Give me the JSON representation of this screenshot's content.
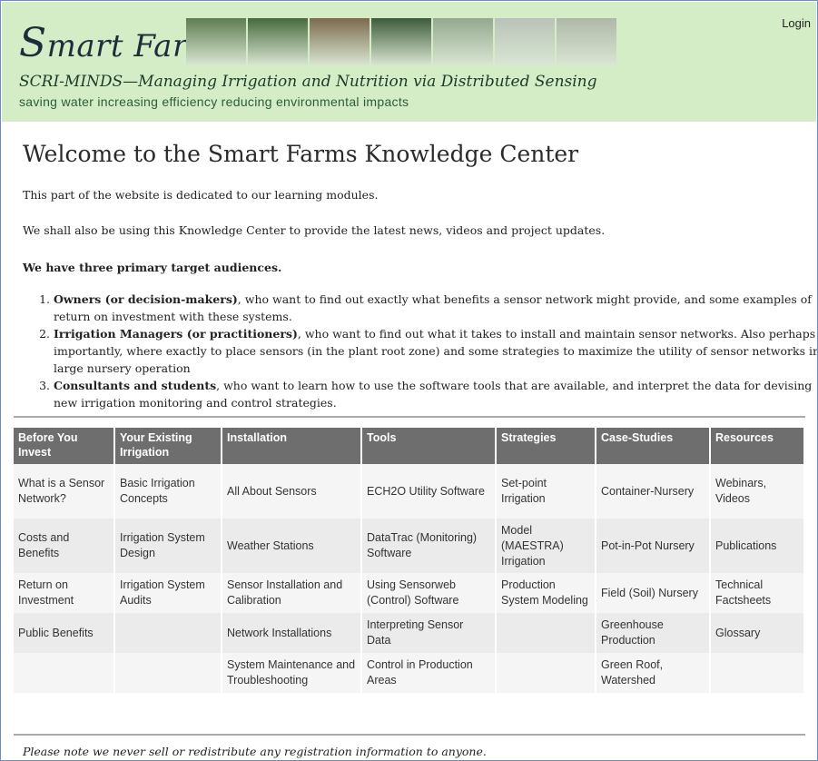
{
  "header": {
    "title_initial": "S",
    "title_rest": "mart Farms",
    "tagline": "SCRI-MINDS—Managing Irrigation and Nutrition via Distributed Sensing",
    "slogan": "saving water   increasing efficiency   reducing environmental impacts",
    "login_label": "Login",
    "photo_colors": [
      "#5f7d52",
      "#486a3f",
      "#7c6b4f",
      "#3e5b3a",
      "#94a88f",
      "#b9c2b8",
      "#aeb8a7"
    ]
  },
  "main": {
    "heading": "Welcome to the Smart Farms Knowledge Center",
    "intro_1": "This part of the website is dedicated to our learning modules.",
    "intro_2": "We shall also be using this Knowledge Center to provide the latest news, videos and project updates.",
    "audience_heading": "We have three primary target audiences.",
    "audiences": [
      {
        "bold": "Owners (or decision-makers)",
        "text": ", who want to find out exactly what benefits a sensor network might provide, and some examples of return on investment with these systems."
      },
      {
        "bold": "Irrigation Managers (or practitioners)",
        "text": ", who want to find out what it takes to install and maintain sensor networks. Also perhaps as importantly, where exactly to place sensors (in the plant root zone) and some strategies to maximize the utility of sensor networks in a large nursery operation"
      },
      {
        "bold": "Consultants and students",
        "text": ", who want to learn how to use the software tools that are available, and interpret the data for devising new irrigation monitoring and control strategies."
      }
    ]
  },
  "modules": {
    "headers": [
      "Before You Invest",
      "Your Existing Irrigation",
      "Installation",
      "Tools",
      "Strategies",
      "Case-Studies",
      "Resources"
    ],
    "rows": [
      [
        "What is a Sensor Network?",
        "Basic Irrigation Concepts",
        "All About Sensors",
        "ECH2O Utility Software",
        "Set-point Irrigation",
        "Container-Nursery",
        "Webinars, Videos"
      ],
      [
        "Costs and Benefits",
        "Irrigation System Design",
        "Weather Stations",
        "DataTrac (Monitoring) Software",
        "Model (MAESTRA) Irrigation",
        "Pot-in-Pot Nursery",
        "Publications"
      ],
      [
        "Return on Investment",
        "Irrigation System Audits",
        "Sensor Installation and Calibration",
        "Using Sensorweb (Control) Software",
        "Production System Modeling",
        "Field (Soil) Nursery",
        "Technical Factsheets"
      ],
      [
        "Public Benefits",
        "",
        "Network Installations",
        "Interpreting Sensor Data",
        "",
        "Greenhouse Production",
        "Glossary"
      ],
      [
        "",
        "",
        "System Maintenance and Troubleshooting",
        "Control in Production Areas",
        "",
        "Green Roof, Watershed",
        ""
      ]
    ]
  },
  "footer": {
    "note": "Please note we never sell or redistribute any registration information to anyone."
  }
}
